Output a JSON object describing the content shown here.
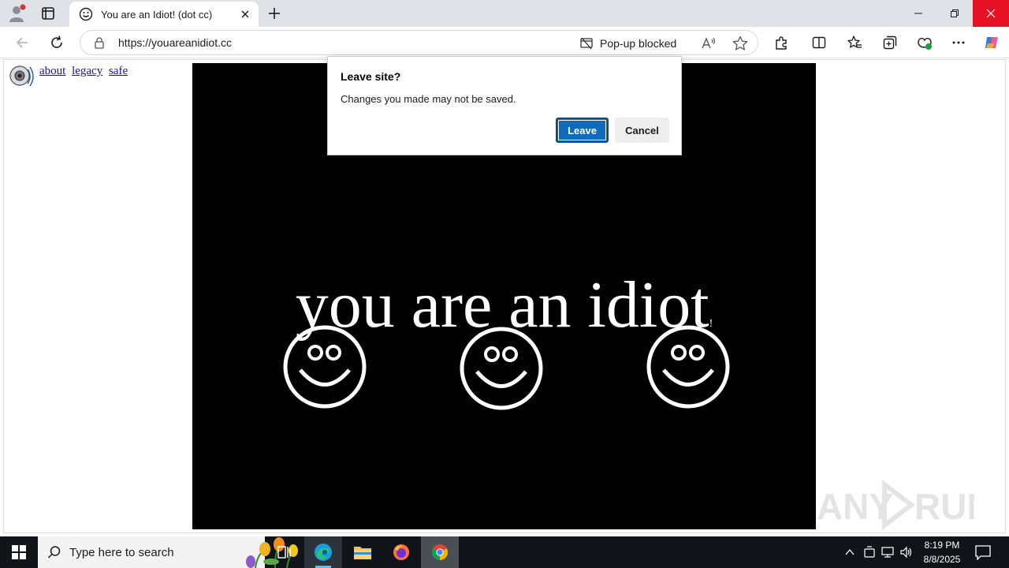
{
  "browser": {
    "tab_title": "You are an Idiot! (dot cc)",
    "url": "https://youareanidiot.cc",
    "popup_blocked_label": "Pop-up blocked"
  },
  "page": {
    "links": [
      "about",
      "legacy",
      "safe"
    ],
    "headline": "you are an idiot",
    "headline_mark": "!",
    "background_color": "#000000",
    "foreground_color": "#ffffff",
    "smiley_count": 3
  },
  "dialog": {
    "title": "Leave site?",
    "message": "Changes you made may not be saved.",
    "leave_label": "Leave",
    "cancel_label": "Cancel",
    "primary_color": "#0f6cbd"
  },
  "watermark": {
    "text": "ANY RUN"
  },
  "taskbar": {
    "search_placeholder": "Type here to search",
    "time": "8:19 PM",
    "date": "8/8/2025",
    "apps": [
      "task-view",
      "edge",
      "file-explorer",
      "firefox",
      "chrome"
    ]
  }
}
